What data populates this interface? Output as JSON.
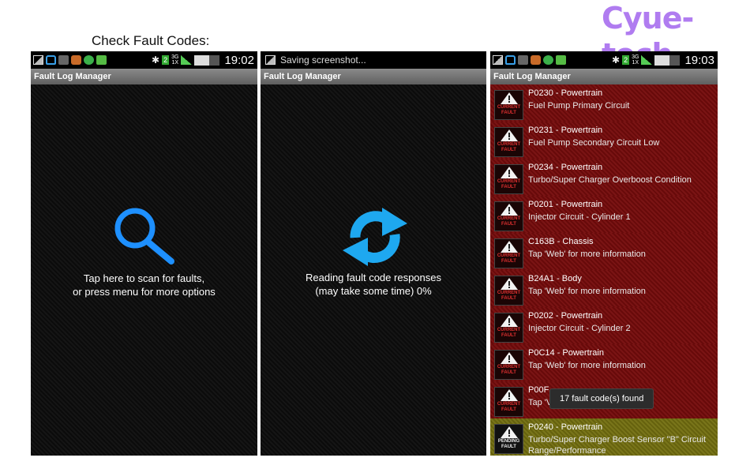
{
  "brand": "Cyue-tech",
  "caption": "Check Fault Codes:",
  "status": {
    "time": "19:02",
    "time_right": "19:03",
    "saving": "Saving screenshot...",
    "sim": "2",
    "net_top": "3G",
    "net_bottom": "1X",
    "g": "G"
  },
  "app_title": "Fault Log Manager",
  "scan_screen": {
    "line1": "Tap here to scan for faults,",
    "line2": "or press menu for more options"
  },
  "reading_screen": {
    "line1": "Reading fault code responses",
    "line2": "(may take some time) 0%"
  },
  "badges": {
    "current_1": "CURRENT",
    "current_2": "FAULT",
    "pending_1": "PENDING",
    "pending_2": "FAULT"
  },
  "faults": [
    {
      "title": "P0230 - Powertrain",
      "desc": "Fuel Pump Primary Circuit",
      "state": "current"
    },
    {
      "title": "P0231 - Powertrain",
      "desc": "Fuel Pump Secondary Circuit Low",
      "state": "current"
    },
    {
      "title": "P0234 - Powertrain",
      "desc": "Turbo/Super Charger Overboost Condition",
      "state": "current"
    },
    {
      "title": "P0201 - Powertrain",
      "desc": "Injector Circuit - Cylinder 1",
      "state": "current"
    },
    {
      "title": "C163B - Chassis",
      "desc": "Tap 'Web' for more information",
      "state": "current"
    },
    {
      "title": "B24A1 - Body",
      "desc": "Tap 'Web' for more information",
      "state": "current"
    },
    {
      "title": "P0202 - Powertrain",
      "desc": "Injector Circuit - Cylinder 2",
      "state": "current"
    },
    {
      "title": "P0C14 - Powertrain",
      "desc": "Tap 'Web' for more information",
      "state": "current"
    },
    {
      "title": "P00F",
      "desc": "Tap 'V",
      "state": "current"
    },
    {
      "title": "P0240 - Powertrain",
      "desc": "Turbo/Super Charger Boost Sensor \"B\" Circuit Range/Performance",
      "state": "pending"
    }
  ],
  "toast": "17 fault code(s) found",
  "colors": {
    "brand": "#b07cf0",
    "accent_icon": "#1e90ff",
    "current_fault_bg": "#6e0d0d",
    "pending_fault_bg": "#6e6a12"
  },
  "icons": {
    "scan": "search-icon",
    "reading": "refresh-icon",
    "badge": "warning-triangle-icon"
  }
}
